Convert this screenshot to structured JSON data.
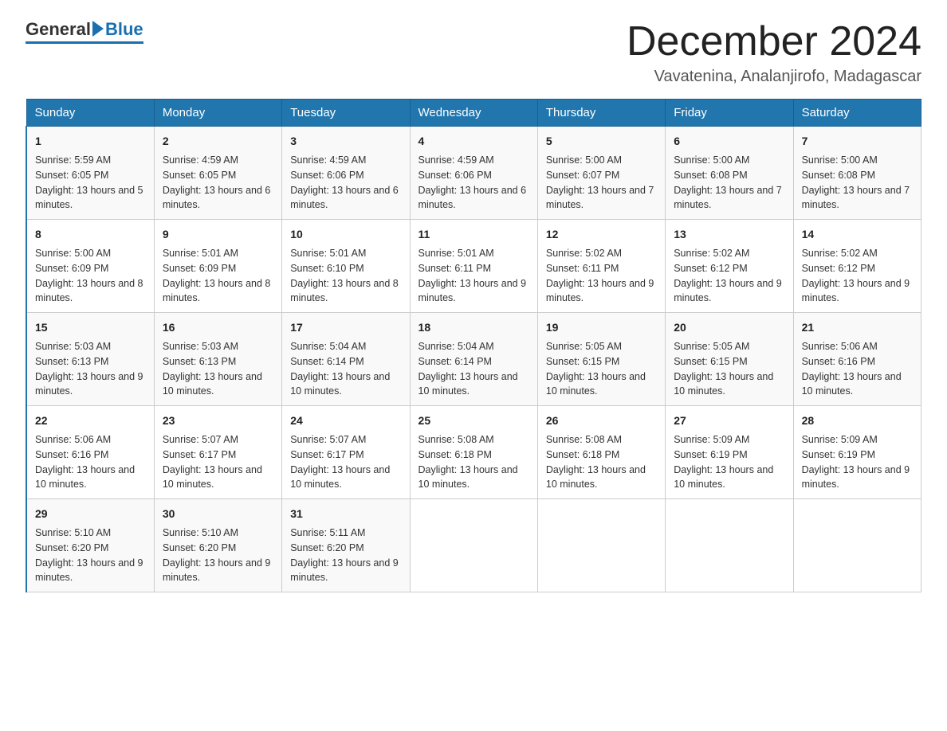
{
  "logo": {
    "text_general": "General",
    "text_blue": "Blue"
  },
  "title": {
    "month_year": "December 2024",
    "location": "Vavatenina, Analanjirofo, Madagascar"
  },
  "days_of_week": [
    "Sunday",
    "Monday",
    "Tuesday",
    "Wednesday",
    "Thursday",
    "Friday",
    "Saturday"
  ],
  "weeks": [
    [
      {
        "day": "1",
        "sunrise": "5:59 AM",
        "sunset": "6:05 PM",
        "daylight": "13 hours and 5 minutes."
      },
      {
        "day": "2",
        "sunrise": "4:59 AM",
        "sunset": "6:05 PM",
        "daylight": "13 hours and 6 minutes."
      },
      {
        "day": "3",
        "sunrise": "4:59 AM",
        "sunset": "6:06 PM",
        "daylight": "13 hours and 6 minutes."
      },
      {
        "day": "4",
        "sunrise": "4:59 AM",
        "sunset": "6:06 PM",
        "daylight": "13 hours and 6 minutes."
      },
      {
        "day": "5",
        "sunrise": "5:00 AM",
        "sunset": "6:07 PM",
        "daylight": "13 hours and 7 minutes."
      },
      {
        "day": "6",
        "sunrise": "5:00 AM",
        "sunset": "6:08 PM",
        "daylight": "13 hours and 7 minutes."
      },
      {
        "day": "7",
        "sunrise": "5:00 AM",
        "sunset": "6:08 PM",
        "daylight": "13 hours and 7 minutes."
      }
    ],
    [
      {
        "day": "8",
        "sunrise": "5:00 AM",
        "sunset": "6:09 PM",
        "daylight": "13 hours and 8 minutes."
      },
      {
        "day": "9",
        "sunrise": "5:01 AM",
        "sunset": "6:09 PM",
        "daylight": "13 hours and 8 minutes."
      },
      {
        "day": "10",
        "sunrise": "5:01 AM",
        "sunset": "6:10 PM",
        "daylight": "13 hours and 8 minutes."
      },
      {
        "day": "11",
        "sunrise": "5:01 AM",
        "sunset": "6:11 PM",
        "daylight": "13 hours and 9 minutes."
      },
      {
        "day": "12",
        "sunrise": "5:02 AM",
        "sunset": "6:11 PM",
        "daylight": "13 hours and 9 minutes."
      },
      {
        "day": "13",
        "sunrise": "5:02 AM",
        "sunset": "6:12 PM",
        "daylight": "13 hours and 9 minutes."
      },
      {
        "day": "14",
        "sunrise": "5:02 AM",
        "sunset": "6:12 PM",
        "daylight": "13 hours and 9 minutes."
      }
    ],
    [
      {
        "day": "15",
        "sunrise": "5:03 AM",
        "sunset": "6:13 PM",
        "daylight": "13 hours and 9 minutes."
      },
      {
        "day": "16",
        "sunrise": "5:03 AM",
        "sunset": "6:13 PM",
        "daylight": "13 hours and 10 minutes."
      },
      {
        "day": "17",
        "sunrise": "5:04 AM",
        "sunset": "6:14 PM",
        "daylight": "13 hours and 10 minutes."
      },
      {
        "day": "18",
        "sunrise": "5:04 AM",
        "sunset": "6:14 PM",
        "daylight": "13 hours and 10 minutes."
      },
      {
        "day": "19",
        "sunrise": "5:05 AM",
        "sunset": "6:15 PM",
        "daylight": "13 hours and 10 minutes."
      },
      {
        "day": "20",
        "sunrise": "5:05 AM",
        "sunset": "6:15 PM",
        "daylight": "13 hours and 10 minutes."
      },
      {
        "day": "21",
        "sunrise": "5:06 AM",
        "sunset": "6:16 PM",
        "daylight": "13 hours and 10 minutes."
      }
    ],
    [
      {
        "day": "22",
        "sunrise": "5:06 AM",
        "sunset": "6:16 PM",
        "daylight": "13 hours and 10 minutes."
      },
      {
        "day": "23",
        "sunrise": "5:07 AM",
        "sunset": "6:17 PM",
        "daylight": "13 hours and 10 minutes."
      },
      {
        "day": "24",
        "sunrise": "5:07 AM",
        "sunset": "6:17 PM",
        "daylight": "13 hours and 10 minutes."
      },
      {
        "day": "25",
        "sunrise": "5:08 AM",
        "sunset": "6:18 PM",
        "daylight": "13 hours and 10 minutes."
      },
      {
        "day": "26",
        "sunrise": "5:08 AM",
        "sunset": "6:18 PM",
        "daylight": "13 hours and 10 minutes."
      },
      {
        "day": "27",
        "sunrise": "5:09 AM",
        "sunset": "6:19 PM",
        "daylight": "13 hours and 10 minutes."
      },
      {
        "day": "28",
        "sunrise": "5:09 AM",
        "sunset": "6:19 PM",
        "daylight": "13 hours and 9 minutes."
      }
    ],
    [
      {
        "day": "29",
        "sunrise": "5:10 AM",
        "sunset": "6:20 PM",
        "daylight": "13 hours and 9 minutes."
      },
      {
        "day": "30",
        "sunrise": "5:10 AM",
        "sunset": "6:20 PM",
        "daylight": "13 hours and 9 minutes."
      },
      {
        "day": "31",
        "sunrise": "5:11 AM",
        "sunset": "6:20 PM",
        "daylight": "13 hours and 9 minutes."
      },
      null,
      null,
      null,
      null
    ]
  ],
  "cell_labels": {
    "sunrise": "Sunrise:",
    "sunset": "Sunset:",
    "daylight": "Daylight:"
  }
}
